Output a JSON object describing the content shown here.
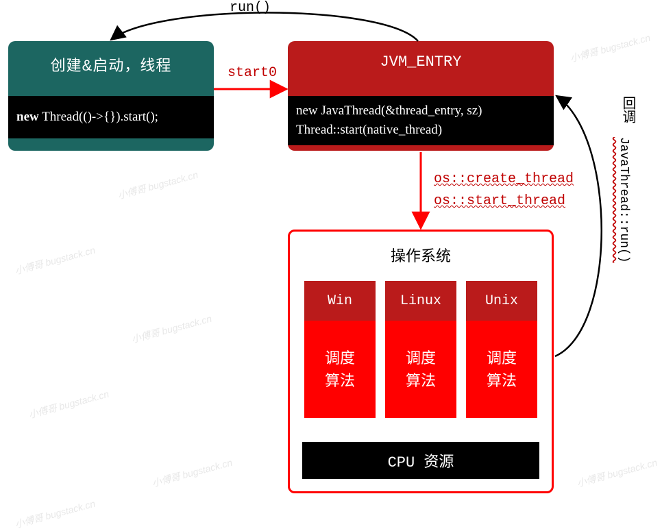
{
  "box1": {
    "title": "创建&启动，线程",
    "code_kw": "new",
    "code_rest": " Thread(()->{}).start();"
  },
  "box2": {
    "title": "JVM_ENTRY",
    "code_line1": "new JavaThread(&thread_entry, sz)",
    "code_line2": "Thread::start(native_thread)"
  },
  "arrows": {
    "start0": "start0",
    "run": "run()",
    "os_create": "os::create_thread",
    "os_start": "os::start_thread",
    "callback": "回调",
    "jt_run": "JavaThread::run()"
  },
  "os": {
    "title": "操作系统",
    "cols": [
      {
        "name": "Win",
        "algo": "调度\n算法"
      },
      {
        "name": "Linux",
        "algo": "调度\n算法"
      },
      {
        "name": "Unix",
        "algo": "调度\n算法"
      }
    ],
    "cpu": "CPU 资源"
  },
  "watermark": "小傅哥 bugstack.cn"
}
